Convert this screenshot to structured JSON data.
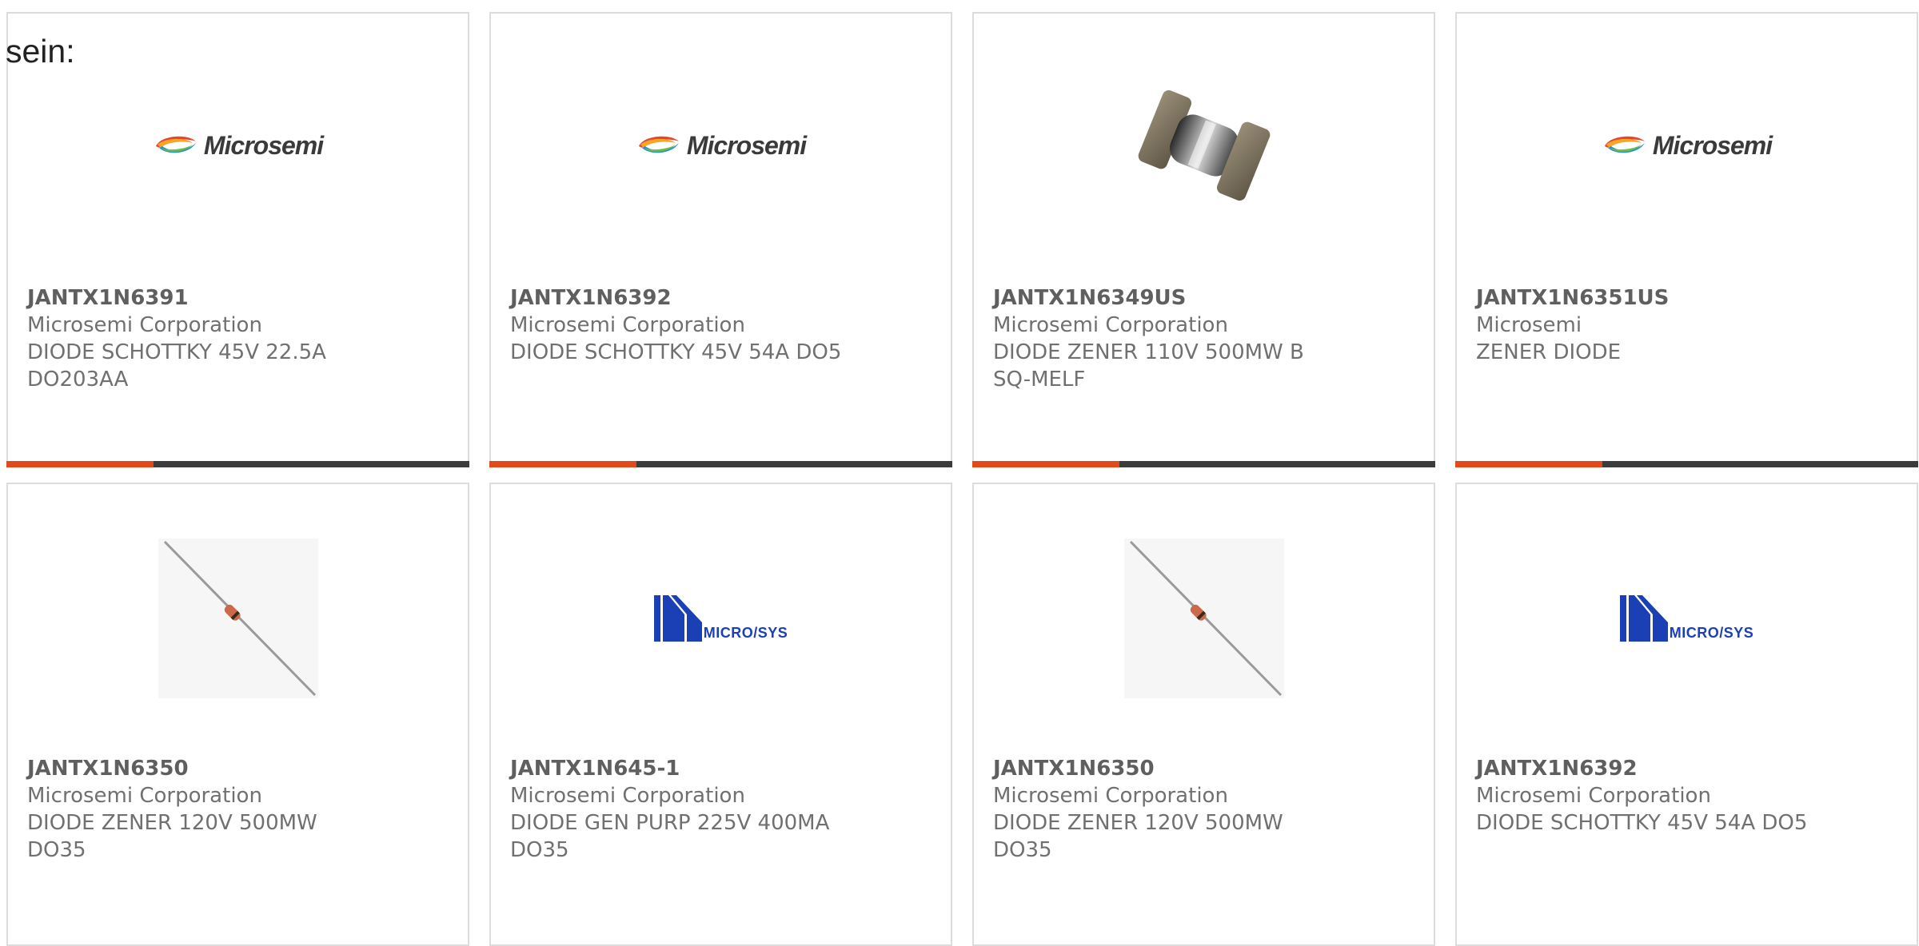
{
  "page": {
    "intro_text": "sein:"
  },
  "colors": {
    "accent_bar": "#e24a1a",
    "bar_base": "#3c3c3c",
    "card_border": "#dcdcdc",
    "text": "#707070"
  },
  "cards": [
    {
      "image": "microsemi-logo",
      "logo_text": "Microsemi",
      "part_number": "JANTX1N6391",
      "manufacturer": "Microsemi Corporation",
      "desc_line1": "DIODE SCHOTTKY 45V 22.5A",
      "desc_line2": "DO203AA"
    },
    {
      "image": "microsemi-logo",
      "logo_text": "Microsemi",
      "part_number": "JANTX1N6392",
      "manufacturer": "Microsemi Corporation",
      "desc_line1": "DIODE SCHOTTKY 45V 54A DO5",
      "desc_line2": ""
    },
    {
      "image": "melf-diode-photo",
      "part_number": "JANTX1N6349US",
      "manufacturer": "Microsemi Corporation",
      "desc_line1": "DIODE ZENER 110V 500MW B",
      "desc_line2": "SQ-MELF"
    },
    {
      "image": "microsemi-logo",
      "logo_text": "Microsemi",
      "part_number": "JANTX1N6351US",
      "manufacturer": "Microsemi",
      "desc_line1": "ZENER DIODE",
      "desc_line2": ""
    },
    {
      "image": "axial-diode-photo",
      "part_number": "JANTX1N6350",
      "manufacturer": "Microsemi Corporation",
      "desc_line1": "DIODE ZENER 120V 500MW",
      "desc_line2": "DO35"
    },
    {
      "image": "microsys-logo",
      "logo_text": "MICRO/SYS",
      "part_number": "JANTX1N645-1",
      "manufacturer": "Microsemi Corporation",
      "desc_line1": "DIODE GEN PURP 225V 400MA",
      "desc_line2": "DO35"
    },
    {
      "image": "axial-diode-photo",
      "part_number": "JANTX1N6350",
      "manufacturer": "Microsemi Corporation",
      "desc_line1": "DIODE ZENER 120V 500MW",
      "desc_line2": "DO35"
    },
    {
      "image": "microsys-logo",
      "logo_text": "MICRO/SYS",
      "part_number": "JANTX1N6392",
      "manufacturer": "Microsemi Corporation",
      "desc_line1": "DIODE SCHOTTKY 45V 54A DO5",
      "desc_line2": ""
    }
  ]
}
